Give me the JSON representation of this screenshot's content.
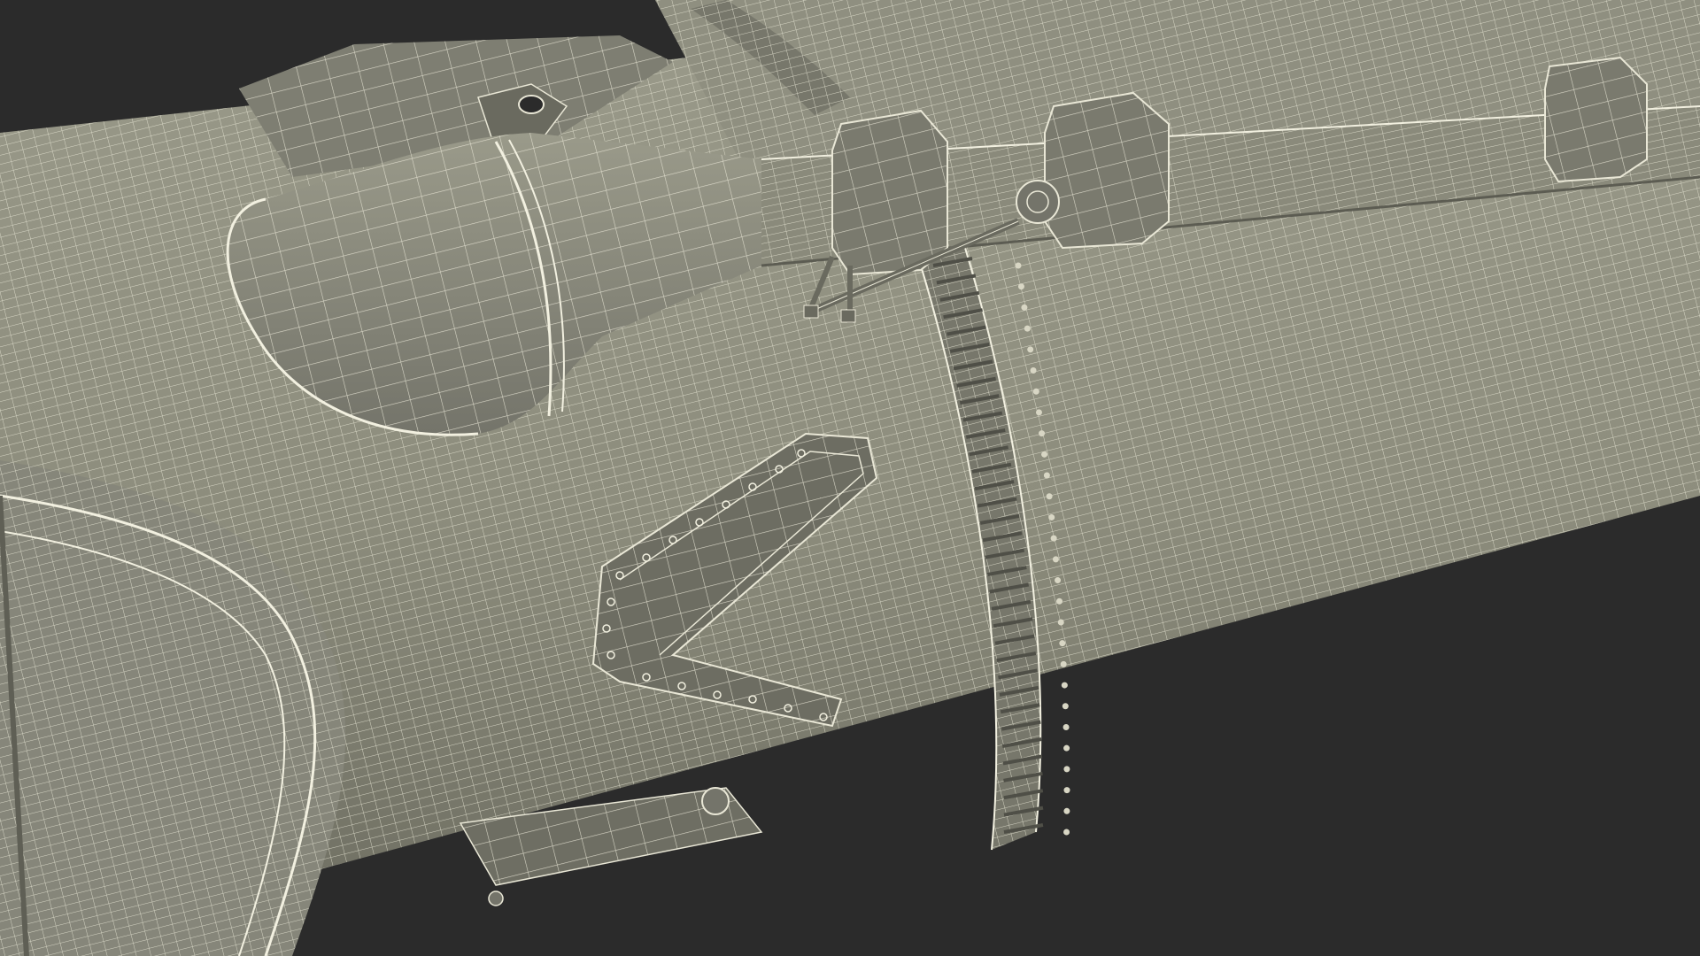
{
  "scene": {
    "subject": "rocket-stage-wireframe",
    "colors": {
      "background": "#2b2b2b",
      "surface": "#8c8c7c",
      "surface_dark": "#6e6e62",
      "surface_light": "#a2a292",
      "wire": "#e9e7d6"
    }
  }
}
